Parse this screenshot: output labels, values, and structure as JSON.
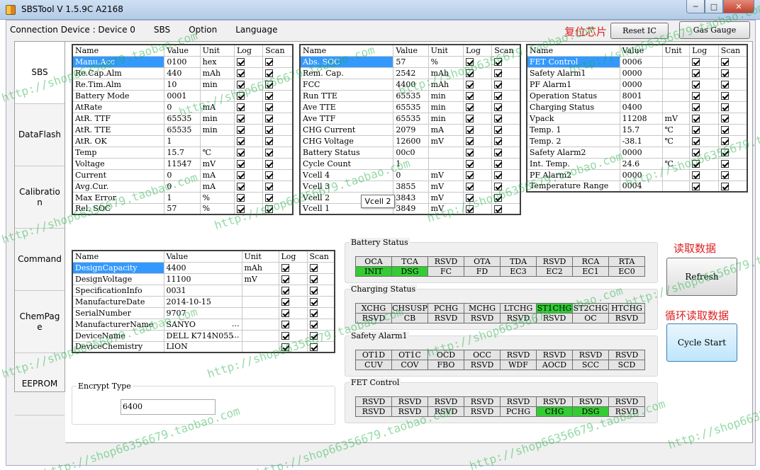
{
  "window": {
    "title": "SBSTool V 1.5.9C A2168"
  },
  "menu": {
    "connection": "Connection Device : Device 0",
    "items": [
      "SBS",
      "Option",
      "Language"
    ]
  },
  "notes": {
    "reset": "复位芯片",
    "read": "读取数据",
    "cycle": "循环读取数据"
  },
  "buttons": {
    "reset_ic": "Reset IC",
    "gas_gauge": "Gas Gauge",
    "refresh": "Refresh",
    "cycle_start": "Cycle Start"
  },
  "sidetabs": [
    "SBS",
    "DataFlash",
    "Calibration",
    "Command",
    "ChemPage",
    "EEPROM"
  ],
  "headers": {
    "name": "Name",
    "value": "Value",
    "unit": "Unit",
    "log": "Log",
    "scan": "Scan"
  },
  "table1": [
    {
      "name": "Manu.Acc",
      "value": "0100",
      "unit": "hex"
    },
    {
      "name": "Re.Cap.Alm",
      "value": "440",
      "unit": "mAh"
    },
    {
      "name": "Re.Tim.Alm",
      "value": "10",
      "unit": "min"
    },
    {
      "name": "Battery Mode",
      "value": "0001",
      "unit": ""
    },
    {
      "name": "AtRate",
      "value": "0",
      "unit": "mA"
    },
    {
      "name": "AtR. TTF",
      "value": "65535",
      "unit": "min"
    },
    {
      "name": "AtR. TTE",
      "value": "65535",
      "unit": "min"
    },
    {
      "name": "AtR. OK",
      "value": "1",
      "unit": ""
    },
    {
      "name": "Temp",
      "value": "15.7",
      "unit": "℃"
    },
    {
      "name": "Voltage",
      "value": "11547",
      "unit": "mV"
    },
    {
      "name": "Current",
      "value": "0",
      "unit": "mA"
    },
    {
      "name": "Avg.Cur.",
      "value": "0",
      "unit": "mA"
    },
    {
      "name": "Max Error",
      "value": "1",
      "unit": "%"
    },
    {
      "name": "Rel. SOC",
      "value": "57",
      "unit": "%"
    }
  ],
  "table2": [
    {
      "name": "Abs. SOC",
      "value": "57",
      "unit": "%"
    },
    {
      "name": "Rem. Cap.",
      "value": "2542",
      "unit": "mAh"
    },
    {
      "name": "FCC",
      "value": "4400",
      "unit": "mAh"
    },
    {
      "name": "Run TTE",
      "value": "65535",
      "unit": "min"
    },
    {
      "name": "Ave TTE",
      "value": "65535",
      "unit": "min"
    },
    {
      "name": "Ave TTF",
      "value": "65535",
      "unit": "min"
    },
    {
      "name": "CHG Current",
      "value": "2079",
      "unit": "mA"
    },
    {
      "name": "CHG Voltage",
      "value": "12600",
      "unit": "mV"
    },
    {
      "name": "Battery Status",
      "value": "00c0",
      "unit": ""
    },
    {
      "name": "Cycle Count",
      "value": "1",
      "unit": ""
    },
    {
      "name": "Vcell 4",
      "value": "0",
      "unit": "mV"
    },
    {
      "name": "Vcell 3",
      "value": "3855",
      "unit": "mV"
    },
    {
      "name": "Vcell 2",
      "value": "3843",
      "unit": "mV"
    },
    {
      "name": "Vcell 1",
      "value": "3849",
      "unit": "mV"
    }
  ],
  "table3": [
    {
      "name": "FET Control",
      "value": "0006",
      "unit": ""
    },
    {
      "name": "Safety Alarm1",
      "value": "0000",
      "unit": ""
    },
    {
      "name": "PF Alarm1",
      "value": "0000",
      "unit": ""
    },
    {
      "name": "Operation Status",
      "value": "8001",
      "unit": ""
    },
    {
      "name": "Charging Status",
      "value": "0400",
      "unit": ""
    },
    {
      "name": "Vpack",
      "value": "11208",
      "unit": "mV"
    },
    {
      "name": "Temp. 1",
      "value": "15.7",
      "unit": "℃"
    },
    {
      "name": "Temp. 2",
      "value": "-38.1",
      "unit": "℃"
    },
    {
      "name": "Safety Alarm2",
      "value": "0000",
      "unit": ""
    },
    {
      "name": "Int. Temp.",
      "value": "24.6",
      "unit": "℃"
    },
    {
      "name": "PF Alarm2",
      "value": "0000",
      "unit": ""
    },
    {
      "name": "Temperature Range",
      "value": "0004",
      "unit": ""
    }
  ],
  "table4": [
    {
      "name": "DesignCapacity",
      "value": "4400",
      "unit": "mAh"
    },
    {
      "name": "DesignVoltage",
      "value": "11100",
      "unit": "mV"
    },
    {
      "name": "SpecificationInfo",
      "value": "0031",
      "unit": ""
    },
    {
      "name": "ManufactureDate",
      "value": "2014-10-15",
      "unit": ""
    },
    {
      "name": "SerialNumber",
      "value": "9707",
      "unit": ""
    },
    {
      "name": "ManufacturerName",
      "value": "SANYO",
      "unit": ""
    },
    {
      "name": "DeviceName",
      "value": "DELL K714N055",
      "unit": ""
    },
    {
      "name": "DeviceChemistry",
      "value": "LION",
      "unit": ""
    }
  ],
  "ellipsis": "...",
  "tooltip": "Vcell 2",
  "encrypt": {
    "label": "Encrypt Type",
    "value": "6400"
  },
  "status_groups": [
    {
      "title": "Battery Status",
      "rows": [
        [
          "OCA",
          "TCA",
          "RSVD",
          "OTA",
          "TDA",
          "RSVD",
          "RCA",
          "RTA"
        ],
        [
          "INIT",
          "DSG",
          "FC",
          "FD",
          "EC3",
          "EC2",
          "EC1",
          "EC0"
        ]
      ],
      "on": [
        [],
        [
          0,
          1
        ]
      ]
    },
    {
      "title": "Charging Status",
      "rows": [
        [
          "XCHG",
          "CHSUSP",
          "PCHG",
          "MCHG",
          "LTCHG",
          "ST1CHG",
          "ST2CHG",
          "HTCHG"
        ],
        [
          "RSVD",
          "CB",
          "RSVD",
          "RSVD",
          "RSVD",
          "RSVD",
          "OC",
          "RSVD"
        ]
      ],
      "on": [
        [
          5
        ],
        []
      ]
    },
    {
      "title": "Safety Alarm1",
      "rows": [
        [
          "OT1D",
          "OT1C",
          "OCD",
          "OCC",
          "RSVD",
          "RSVD",
          "RSVD",
          "RSVD"
        ],
        [
          "CUV",
          "COV",
          "FBO",
          "RSVD",
          "WDF",
          "AOCD",
          "SCC",
          "SCD"
        ]
      ],
      "on": [
        [],
        []
      ]
    },
    {
      "title": "FET Control",
      "rows": [
        [
          "RSVD",
          "RSVD",
          "RSVD",
          "RSVD",
          "RSVD",
          "RSVD",
          "RSVD",
          "RSVD"
        ],
        [
          "RSVD",
          "RSVD",
          "RSVD",
          "RSVD",
          "PCHG",
          "CHG",
          "DSG",
          "RSVD"
        ]
      ],
      "on": [
        [],
        [
          5,
          6
        ]
      ]
    }
  ],
  "watermark": "http://shop66356679.taobao.com",
  "colors": {
    "status_on": "#33cc33",
    "selection": "#3399ff",
    "note_red": "#dd2222",
    "watermark": "#14aa3c"
  }
}
